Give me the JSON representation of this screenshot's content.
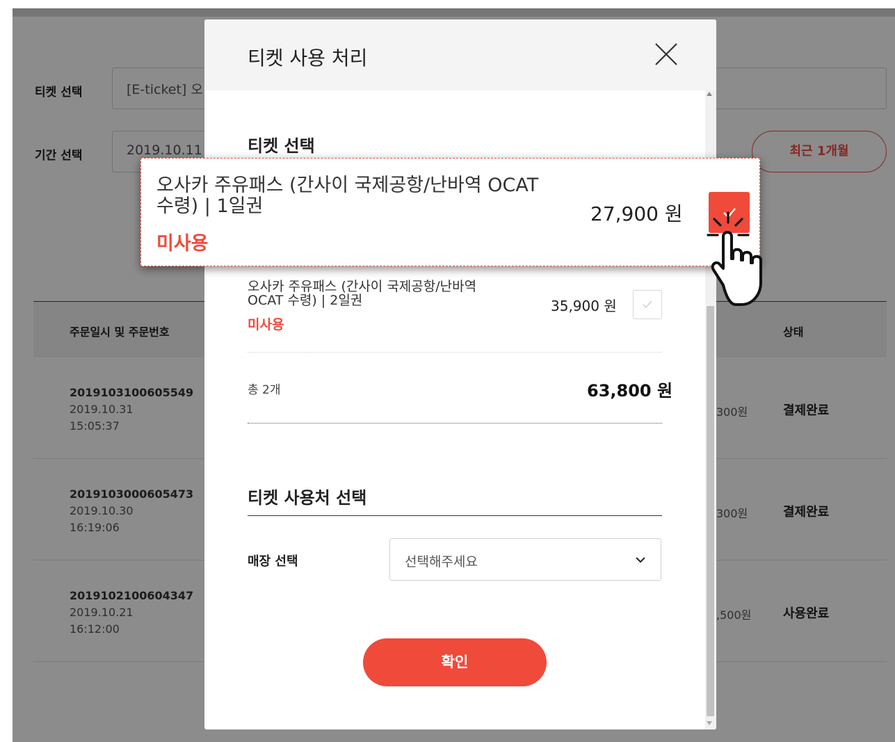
{
  "background": {
    "ticket_select_label": "티켓 선택",
    "ticket_select_value": "[E-ticket] 오",
    "period_select_label": "기간 선택",
    "period_start": "2019.10.11",
    "recent_button": "최근 1개월",
    "table": {
      "headers": {
        "order": "주문일시 및 주문번호",
        "status": "상태"
      },
      "rows": [
        {
          "order_no": "2019103100605549",
          "date": "2019.10.31",
          "time": "15:05:37",
          "amount": "300원",
          "status": "결제완료"
        },
        {
          "order_no": "2019103000605473",
          "date": "2019.10.30",
          "time": "16:19:06",
          "amount": "300원",
          "status": "결제완료"
        },
        {
          "order_no": "2019102100604347",
          "date": "2019.10.21",
          "time": "16:12:00",
          "amount": ",500원",
          "status": "사용완료"
        }
      ]
    }
  },
  "modal": {
    "title": "티켓 사용 처리",
    "section_ticket": "티켓 선택",
    "items": [
      {
        "name": "오사카 주유패스 (간사이 국제공항/난바역 OCAT 수령) | 1일권",
        "status": "미사용",
        "price": "27,900 원",
        "checked": true
      },
      {
        "name": "오사카 주유패스 (간사이 국제공항/난바역 OCAT 수령) | 2일권",
        "status": "미사용",
        "price": "35,900 원",
        "checked": false
      }
    ],
    "total_label": "총 2개",
    "total_value": "63,800 원",
    "section_place": "티켓 사용처 선택",
    "store_label": "매장 선택",
    "store_placeholder": "선택해주세요",
    "confirm_label": "확인"
  },
  "colors": {
    "accent": "#f04a3b",
    "overlay": "rgba(0,0,0,0.45)"
  },
  "icons": {
    "close": "close-icon",
    "check": "check-icon",
    "chevron": "chevron-down-icon",
    "cursor": "hand-pointer-icon"
  }
}
